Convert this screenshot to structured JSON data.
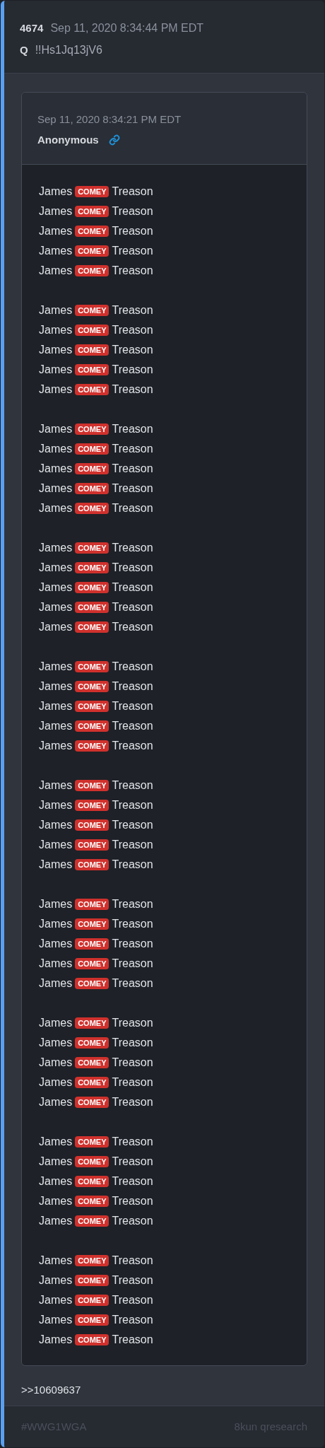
{
  "post": {
    "number": "4674",
    "date": "Sep 11, 2020 8:34:44 PM EDT",
    "author": "Q",
    "tripcode": "!!Hs1Jq13jV6"
  },
  "quote": {
    "date": "Sep 11, 2020 8:34:21 PM EDT",
    "name": "Anonymous",
    "groups": [
      [
        {
          "pre": "James",
          "tag": "COMEY",
          "post": "Treason"
        },
        {
          "pre": "James",
          "tag": "COMEY",
          "post": "Treason"
        },
        {
          "pre": "James",
          "tag": "COMEY",
          "post": "Treason"
        },
        {
          "pre": "James",
          "tag": "COMEY",
          "post": "Treason"
        },
        {
          "pre": "James",
          "tag": "COMEY",
          "post": "Treason"
        }
      ],
      [
        {
          "pre": "James",
          "tag": "COMEY",
          "post": "Treason"
        },
        {
          "pre": "James",
          "tag": "COMEY",
          "post": "Treason"
        },
        {
          "pre": "James",
          "tag": "COMEY",
          "post": "Treason"
        },
        {
          "pre": "James",
          "tag": "COMEY",
          "post": "Treason"
        },
        {
          "pre": "James",
          "tag": "COMEY",
          "post": "Treason"
        }
      ],
      [
        {
          "pre": "James",
          "tag": "COMEY",
          "post": "Treason"
        },
        {
          "pre": "James",
          "tag": "COMEY",
          "post": "Treason"
        },
        {
          "pre": "James",
          "tag": "COMEY",
          "post": "Treason"
        },
        {
          "pre": "James",
          "tag": "COMEY",
          "post": "Treason"
        },
        {
          "pre": "James",
          "tag": "COMEY",
          "post": "Treason"
        }
      ],
      [
        {
          "pre": "James",
          "tag": "COMEY",
          "post": "Treason"
        },
        {
          "pre": "James",
          "tag": "COMEY",
          "post": "Treason"
        },
        {
          "pre": "James",
          "tag": "COMEY",
          "post": "Treason"
        },
        {
          "pre": "James",
          "tag": "COMEY",
          "post": "Treason"
        },
        {
          "pre": "James",
          "tag": "COMEY",
          "post": "Treason"
        }
      ],
      [
        {
          "pre": "James",
          "tag": "COMEY",
          "post": "Treason"
        },
        {
          "pre": "James",
          "tag": "COMEY",
          "post": "Treason"
        },
        {
          "pre": "James",
          "tag": "COMEY",
          "post": "Treason"
        },
        {
          "pre": "James",
          "tag": "COMEY",
          "post": "Treason"
        },
        {
          "pre": "James",
          "tag": "COMEY",
          "post": "Treason"
        }
      ],
      [
        {
          "pre": "James",
          "tag": "COMEY",
          "post": "Treason"
        },
        {
          "pre": "James",
          "tag": "COMEY",
          "post": "Treason"
        },
        {
          "pre": "James",
          "tag": "COMEY",
          "post": "Treason"
        },
        {
          "pre": "James",
          "tag": "COMEY",
          "post": "Treason"
        },
        {
          "pre": "James",
          "tag": "COMEY",
          "post": "Treason"
        }
      ],
      [
        {
          "pre": "James",
          "tag": "COMEY",
          "post": "Treason"
        },
        {
          "pre": "James",
          "tag": "COMEY",
          "post": "Treason"
        },
        {
          "pre": "James",
          "tag": "COMEY",
          "post": "Treason"
        },
        {
          "pre": "James",
          "tag": "COMEY",
          "post": "Treason"
        },
        {
          "pre": "James",
          "tag": "COMEY",
          "post": "Treason"
        }
      ],
      [
        {
          "pre": "James",
          "tag": "COMEY",
          "post": "Treason"
        },
        {
          "pre": "James",
          "tag": "COMEY",
          "post": "Treason"
        },
        {
          "pre": "James",
          "tag": "COMEY",
          "post": "Treason"
        },
        {
          "pre": "James",
          "tag": "COMEY",
          "post": "Treason"
        },
        {
          "pre": "James",
          "tag": "COMEY",
          "post": "Treason"
        }
      ],
      [
        {
          "pre": "James",
          "tag": "COMEY",
          "post": "Treason"
        },
        {
          "pre": "James",
          "tag": "COMEY",
          "post": "Treason"
        },
        {
          "pre": "James",
          "tag": "COMEY",
          "post": "Treason"
        },
        {
          "pre": "James",
          "tag": "COMEY",
          "post": "Treason"
        },
        {
          "pre": "James",
          "tag": "COMEY",
          "post": "Treason"
        }
      ],
      [
        {
          "pre": "James",
          "tag": "COMEY",
          "post": "Treason"
        },
        {
          "pre": "James",
          "tag": "COMEY",
          "post": "Treason"
        },
        {
          "pre": "James",
          "tag": "COMEY",
          "post": "Treason"
        },
        {
          "pre": "James",
          "tag": "COMEY",
          "post": "Treason"
        },
        {
          "pre": "James",
          "tag": "COMEY",
          "post": "Treason"
        }
      ]
    ]
  },
  "reply_link": ">>10609637",
  "footer": {
    "hashtag": "#WWG1WGA",
    "source": "8kun qresearch"
  }
}
